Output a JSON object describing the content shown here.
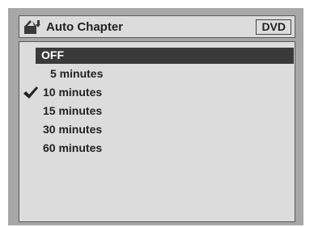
{
  "header": {
    "title": "Auto Chapter",
    "icon": "chapter-icon",
    "badge": "DVD"
  },
  "options": [
    {
      "label": "OFF",
      "highlighted": true,
      "checked": false
    },
    {
      "label": "5 minutes",
      "highlighted": false,
      "checked": false
    },
    {
      "label": "10 minutes",
      "highlighted": false,
      "checked": true
    },
    {
      "label": "15 minutes",
      "highlighted": false,
      "checked": false
    },
    {
      "label": "30 minutes",
      "highlighted": false,
      "checked": false
    },
    {
      "label": "60 minutes",
      "highlighted": false,
      "checked": false
    }
  ],
  "colors": {
    "frame": "#a7a7a7",
    "panel": "#dcdcdc",
    "highlight": "#3a3a3a",
    "text": "#222222"
  }
}
